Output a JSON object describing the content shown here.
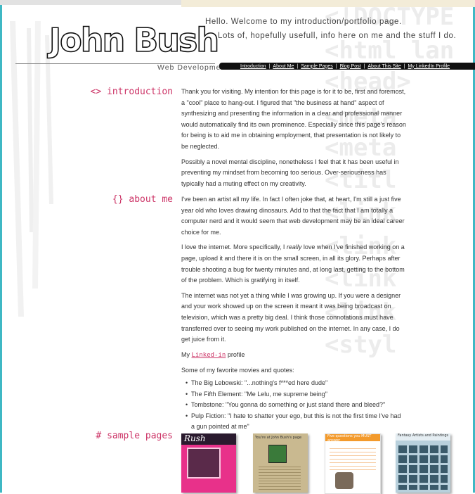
{
  "header": {
    "logo": "John Bush",
    "tagline": "Web Development",
    "welcome_line1": "Hello.  Welcome to my introduction/portfolio page.",
    "welcome_line2": "Lots of, hopefully usefull, info here on me and the stuff I do."
  },
  "nav": {
    "items": [
      "Introduction",
      "About Me",
      "Sample Pages",
      "Blog Post",
      "About This Site",
      "My LinkedIn Profile"
    ],
    "separator": "|"
  },
  "background_code": [
    "<!DOCTYPE",
    "<html lan",
    "<head>",
    "<meta",
    "<meta",
    "<titl",
    "<link",
    "<link",
    "<link",
    "<link",
    "<styl"
  ],
  "intro": {
    "title": "<> introduction",
    "p1": "Thank you for visiting. My intention for this page is for it to be, first and foremost, a \"cool\" place to hang-out. I figured that \"the business at hand\" aspect of synthesizing and presenting the information in a clear and professional manner would automatically find its own prominence. Especially since this page's reason for being is to aid me in obtaining employment, that presentation is not likely to be neglected.",
    "p2": "Possibly a novel mental discipline, nonetheless I feel that it has been useful in preventing my mindset from becoming too serious. Over-seriousness has typically had a muting effect on my creativity."
  },
  "about": {
    "title": "{} about me",
    "p1": "I've been an artist all my life. In fact I often joke that, at heart, I'm still a just five year old who loves drawing dinosaurs. Add to that the fact that I am totally a computer nerd and it would seem that web development may be an ideal career choice for me.",
    "p2_before": "I love the internet. More specifically, I ",
    "p2_em": "really",
    "p2_after": " love when I've finished working on a page, upload it and there it is on the small screen, in all its glory. Perhaps after trouble shooting a bug for twenty minutes and, at long last, getting to the bottom of the problem. Which is gratifying in itself.",
    "p3": "The internet was not yet a thing while I was growing up. If you were a designer and your work showed up on the screen it meant it was being broadcast on television, which was a pretty big deal. I think those connotations must have transferred over to seeing my work published on the internet. In any case, I do get juice from it.",
    "linkedin_prefix": "My",
    "linkedin_link": "Linked-in",
    "linkedin_suffix": "profile",
    "quotes_intro": "Some of my favorite movies and quotes:",
    "quotes": [
      "The Big Lebowski: \"...nothing's f***ed here dude\"",
      "The Fifth Element: \"Me Lelu, me supreme being\"",
      "Tombstone: \"You gonna do something or just stand there and bleed?\"",
      "Pulp Fiction: \"I hate to shatter your ego, but this is not the first time I've had a gun pointed at me\""
    ]
  },
  "samples": {
    "title": "# sample pages",
    "thumbs": [
      {
        "label": "Rush"
      },
      {
        "label": "You're at John Bush's page"
      },
      {
        "label": "Five questions you MUST answer"
      },
      {
        "label": "Fantasy Artists and Paintings"
      }
    ]
  },
  "colors": {
    "accent": "#cc3366",
    "frame": "#3fb8c4",
    "nav_bg": "#111111"
  }
}
